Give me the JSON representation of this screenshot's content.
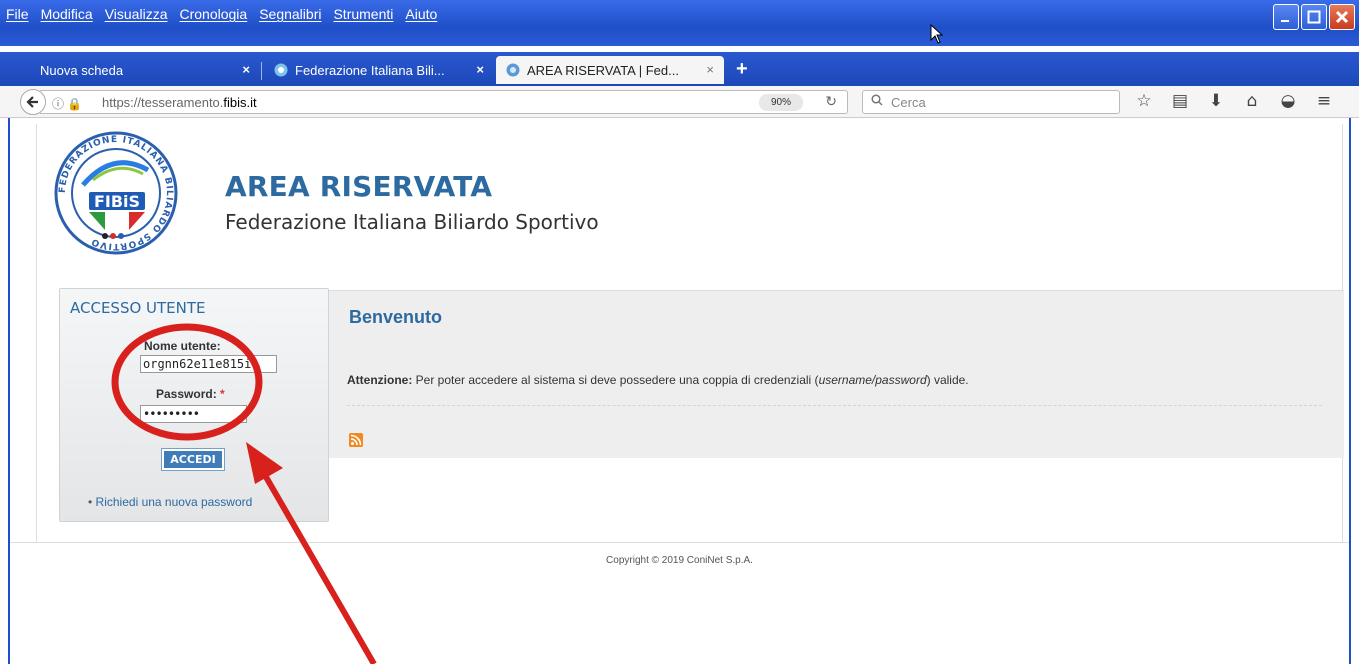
{
  "browser": {
    "menu": [
      "File",
      "Modifica",
      "Visualizza",
      "Cronologia",
      "Segnalibri",
      "Strumenti",
      "Aiuto"
    ],
    "tabs": [
      {
        "label": "Nuova scheda",
        "close": "×"
      },
      {
        "label": "Federazione Italiana Bili...",
        "close": "×"
      },
      {
        "label": "AREA RISERVATA | Fed...",
        "close": "×"
      }
    ],
    "new_tab": "+",
    "url_prefix": "https://tesseramento.",
    "url_domain": "fibis.it",
    "url_icons": "ⓘ 🔒",
    "zoom": "90%",
    "search_placeholder": "Cerca",
    "icons": [
      "star-icon",
      "bookmarks-library-icon",
      "download-icon",
      "home-icon",
      "pocket-icon",
      "menu-icon"
    ]
  },
  "site": {
    "logo_text": "FIBiS",
    "logo_ring": "FEDERAZIONE ITALIANA BILIARDO SPORTIVO",
    "title": "AREA RISERVATA",
    "subtitle": "Federazione Italiana Biliardo Sportivo"
  },
  "login": {
    "title": "ACCESSO UTENTE",
    "username_label": "Nome utente:",
    "username_value": "orgnn62e11e815i",
    "password_label": "Password:",
    "password_value": "•••••••••",
    "required_mark": "*",
    "submit_label": "ACCEDI",
    "forgot_link": "Richiedi una nuova password"
  },
  "content": {
    "title": "Benvenuto",
    "notice_strong": "Attenzione:",
    "notice_text": " Per poter accedere al sistema si deve possedere una coppia di credenziali (",
    "notice_em": "username/password",
    "notice_end": ") valide."
  },
  "footer": {
    "copyright": "Copyright © 2019 ConiNet S.p.A."
  },
  "colors": {
    "accent": "#2d6a9f",
    "titlebar": "#1f4fc8",
    "annotation": "#d8201c"
  }
}
